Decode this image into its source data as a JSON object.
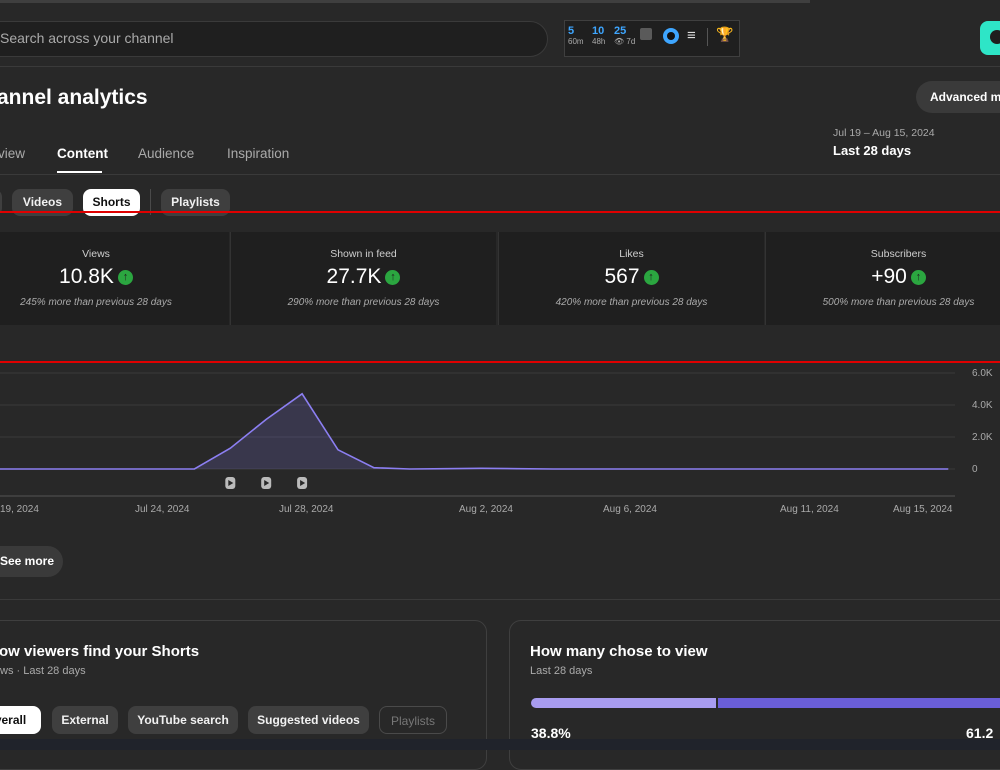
{
  "header": {
    "search_placeholder": "Search across your channel",
    "ext_stats": [
      {
        "num": "5",
        "sub": "60m"
      },
      {
        "num": "10",
        "sub": "48h"
      },
      {
        "num": "25",
        "sub": "👁 7d"
      }
    ]
  },
  "page": {
    "title": "annel analytics",
    "advanced_mode": "Advanced mo",
    "tabs": [
      "view",
      "Content",
      "Audience",
      "Inspiration"
    ],
    "date_range": "Jul 19 – Aug 15, 2024",
    "date_period": "Last 28 days"
  },
  "content_chips": [
    "Videos",
    "Shorts",
    "Playlists"
  ],
  "metrics": [
    {
      "label": "Views",
      "value": "10.8K",
      "change": "245% more than previous 28 days"
    },
    {
      "label": "Shown in feed",
      "value": "27.7K",
      "change": "290% more than previous 28 days"
    },
    {
      "label": "Likes",
      "value": "567",
      "change": "420% more than previous 28 days"
    },
    {
      "label": "Subscribers",
      "value": "+90",
      "change": "500% more than previous 28 days"
    }
  ],
  "chart_data": {
    "type": "area",
    "x": [
      "Jul 19",
      "Jul 20",
      "Jul 21",
      "Jul 22",
      "Jul 23",
      "Jul 24",
      "Jul 25",
      "Jul 26",
      "Jul 27",
      "Jul 28",
      "Jul 29",
      "Jul 30",
      "Jul 31",
      "Aug 1",
      "Aug 2",
      "Aug 3",
      "Aug 4",
      "Aug 5",
      "Aug 6",
      "Aug 7",
      "Aug 8",
      "Aug 9",
      "Aug 10",
      "Aug 11",
      "Aug 12",
      "Aug 13",
      "Aug 14",
      "Aug 15"
    ],
    "series": [
      {
        "values": [
          0,
          0,
          0,
          0,
          0,
          0,
          0,
          1300,
          3100,
          4700,
          1200,
          80,
          0,
          20,
          40,
          20,
          0,
          0,
          0,
          0,
          0,
          0,
          0,
          0,
          0,
          0,
          0,
          0
        ]
      }
    ],
    "ylim": [
      0,
      6000
    ],
    "y_ticks": [
      "6.0K",
      "4.0K",
      "2.0K",
      "0"
    ],
    "x_tick_labels": [
      "19, 2024",
      "Jul 24, 2024",
      "Jul 28, 2024",
      "Aug 2, 2024",
      "Aug 6, 2024",
      "Aug 11, 2024",
      "Aug 15, 2024"
    ],
    "grid": true,
    "line_color": "#8c7ff2"
  },
  "see_more": "See more",
  "panel_left": {
    "title": "ow viewers find your Shorts",
    "subtitle": "ws · Last 28 days",
    "chips": [
      "verall",
      "External",
      "YouTube search",
      "Suggested videos",
      "Playlists"
    ]
  },
  "panel_right": {
    "title": "How many chose to view",
    "subtitle": "Last 28 days",
    "left_pct": "38.8%",
    "right_pct": "61.2"
  },
  "colors": {
    "accent_up": "#2ba640",
    "highlight": "#e00000",
    "teal": "#2ee5c7"
  }
}
